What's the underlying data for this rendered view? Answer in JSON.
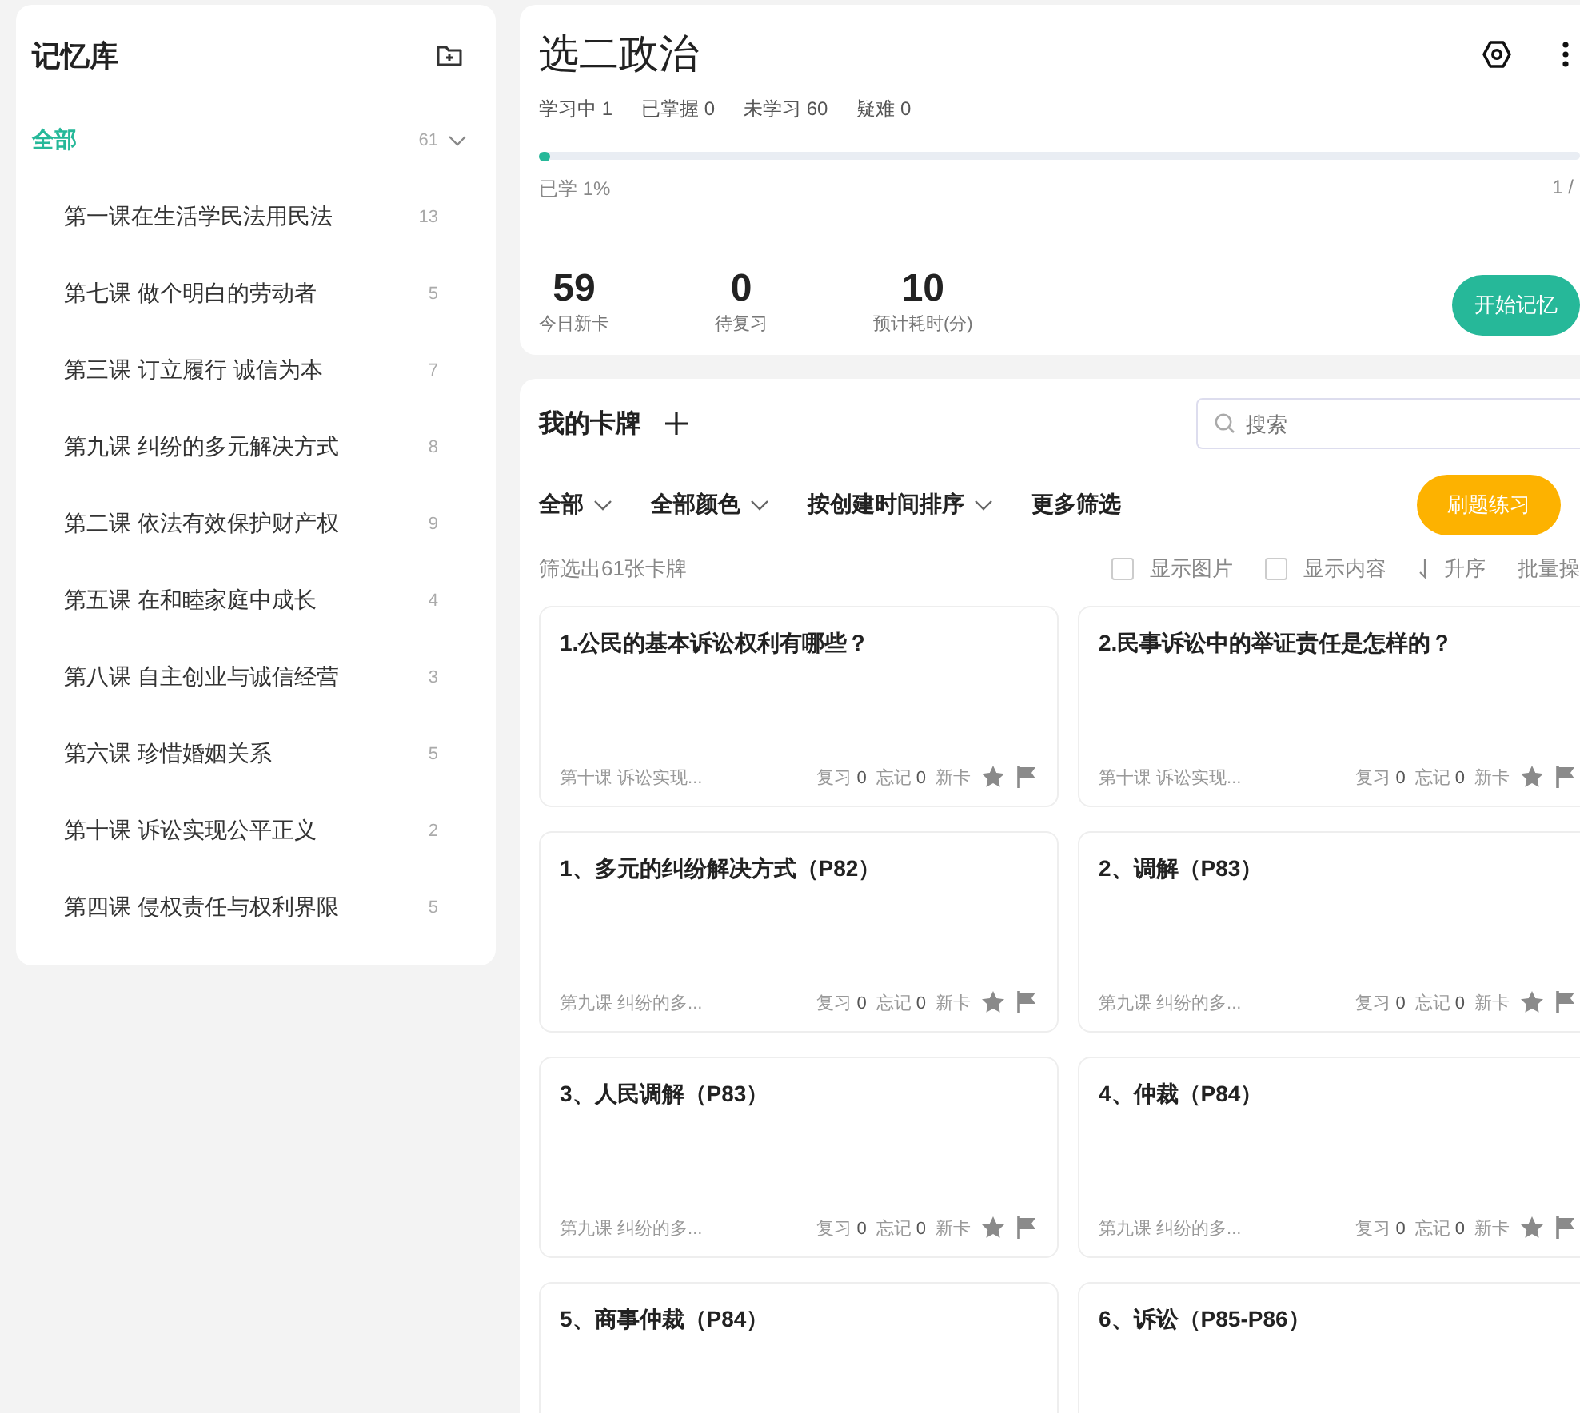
{
  "sidebar": {
    "title": "记忆库",
    "items": [
      {
        "label": "全部",
        "count": "61",
        "selected": true,
        "expanded": true,
        "children": [
          {
            "label": "第一课在生活学民法用民法",
            "count": "13",
            "selected": false
          },
          {
            "label": "第七课 做个明白的劳动者",
            "count": "5",
            "selected": false
          },
          {
            "label": "第三课 订立履行 诚信为本",
            "count": "7",
            "selected": false
          },
          {
            "label": "第九课 纠纷的多元解决方式",
            "count": "8",
            "selected": false
          },
          {
            "label": "第二课 依法有效保护财产权",
            "count": "9",
            "selected": false
          },
          {
            "label": "第五课 在和睦家庭中成长",
            "count": "4",
            "selected": false
          },
          {
            "label": "第八课 自主创业与诚信经营",
            "count": "3",
            "selected": false
          },
          {
            "label": "第六课 珍惜婚姻关系",
            "count": "5",
            "selected": false
          },
          {
            "label": "第十课 诉讼实现公平正义",
            "count": "2",
            "selected": false
          },
          {
            "label": "第四课 侵权责任与权利界限",
            "count": "5",
            "selected": false
          }
        ]
      }
    ]
  },
  "deck": {
    "title": "选二政治",
    "stats": [
      {
        "label": "学习中",
        "value": "1"
      },
      {
        "label": "已掌握",
        "value": "0"
      },
      {
        "label": "未学习",
        "value": "60"
      },
      {
        "label": "疑难",
        "value": "0"
      }
    ],
    "progress": {
      "level": 0.01,
      "caption": "已学 1%",
      "count": "1 /"
    },
    "summary": [
      {
        "value": "59",
        "label": "今日新卡"
      },
      {
        "value": "0",
        "label": "待复习"
      },
      {
        "value": "10",
        "label": "预计耗时(分)"
      }
    ],
    "start_button": "开始记忆"
  },
  "cards_panel": {
    "title": "我的卡牌",
    "search": {
      "placeholder": "搜索"
    },
    "filters": [
      {
        "label": "全部",
        "dropdown": true
      },
      {
        "label": "全部颜色",
        "dropdown": true
      },
      {
        "label": "按创建时间排序",
        "dropdown": true
      },
      {
        "label": "更多筛选",
        "dropdown": false
      }
    ],
    "practice_button": "刷题练习",
    "result": "筛选出61张卡牌",
    "options": [
      {
        "label": "显示图片",
        "checked": false
      },
      {
        "label": "显示内容",
        "checked": false
      }
    ],
    "sort": "升序",
    "batch": "批量操",
    "cards": [
      {
        "title": "1.公民的基本诉讼权利有哪些？",
        "lesson": "第十课 诉讼实现...",
        "review_label": "复习",
        "review": "0",
        "forget_label": "忘记",
        "forget": "0",
        "status": "新卡"
      },
      {
        "title": "2.民事诉讼中的举证责任是怎样的？",
        "lesson": "第十课 诉讼实现...",
        "review_label": "复习",
        "review": "0",
        "forget_label": "忘记",
        "forget": "0",
        "status": "新卡"
      },
      {
        "title": "1、多元的纠纷解决方式（P82）",
        "lesson": "第九课 纠纷的多...",
        "review_label": "复习",
        "review": "0",
        "forget_label": "忘记",
        "forget": "0",
        "status": "新卡"
      },
      {
        "title": "2、调解（P83）",
        "lesson": "第九课 纠纷的多...",
        "review_label": "复习",
        "review": "0",
        "forget_label": "忘记",
        "forget": "0",
        "status": "新卡"
      },
      {
        "title": "3、人民调解（P83）",
        "lesson": "第九课 纠纷的多...",
        "review_label": "复习",
        "review": "0",
        "forget_label": "忘记",
        "forget": "0",
        "status": "新卡"
      },
      {
        "title": "4、仲裁（P84）",
        "lesson": "第九课 纠纷的多...",
        "review_label": "复习",
        "review": "0",
        "forget_label": "忘记",
        "forget": "0",
        "status": "新卡"
      },
      {
        "title": "5、商事仲裁（P84）"
      },
      {
        "title": "6、诉讼（P85-P86）"
      }
    ]
  }
}
